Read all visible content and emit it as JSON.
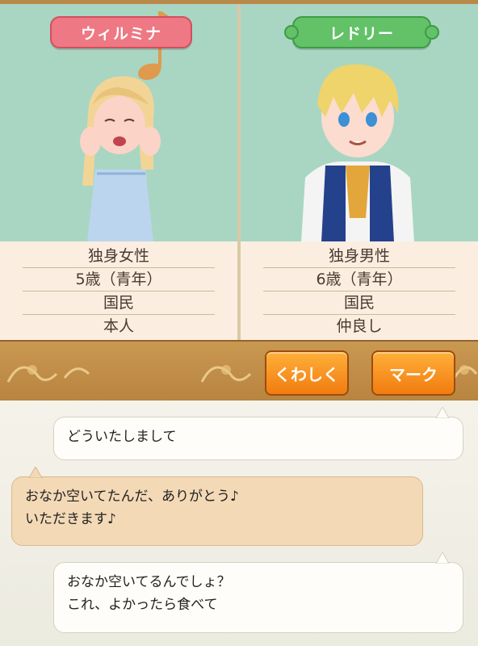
{
  "left_character": {
    "name": "ウィルミナ",
    "info": [
      "独身女性",
      "5歳（青年）",
      "国民",
      "本人"
    ]
  },
  "right_character": {
    "name": "レドリー",
    "info": [
      "独身男性",
      "6歳（青年）",
      "国民",
      "仲良し"
    ]
  },
  "buttons": {
    "details": "くわしく",
    "mark": "マーク"
  },
  "chat": {
    "messages": [
      {
        "speaker": "right",
        "text": "どういたしまして"
      },
      {
        "speaker": "left",
        "line1": "おなか空いてたんだ、ありがとう♪",
        "line2": "いただきます♪"
      },
      {
        "speaker": "right",
        "line1": "おなか空いてるんでしょ？",
        "line2": "これ、よかったら食べて"
      }
    ]
  },
  "colors": {
    "panel_bg": "#a9d6c3",
    "left_tag": "#ee7883",
    "right_tag": "#63c167",
    "button_orange": "#f17c10"
  }
}
